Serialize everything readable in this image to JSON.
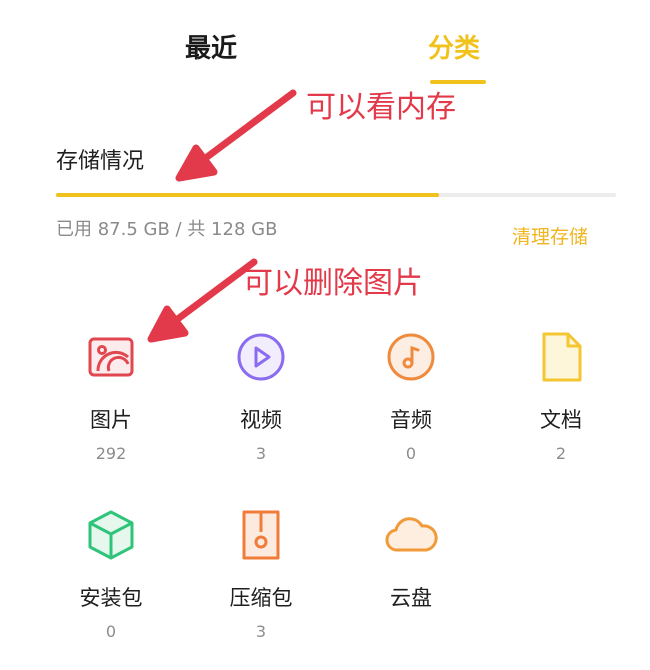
{
  "tabs": [
    {
      "label": "最近",
      "active": false
    },
    {
      "label": "分类",
      "active": true
    }
  ],
  "annotations": {
    "first": "可以看内存",
    "second": "可以删除图片",
    "color": "#e23a4a"
  },
  "storage": {
    "title": "存储情况",
    "usage_text": "已用 87.5 GB / 共 128 GB",
    "used_fraction": 0.684,
    "clean_label": "清理存储"
  },
  "categories": [
    {
      "label": "图片",
      "count": "292",
      "icon": "image-icon",
      "color": "#e0474e"
    },
    {
      "label": "视频",
      "count": "3",
      "icon": "video-play-icon",
      "color": "#8a6cf0"
    },
    {
      "label": "音频",
      "count": "0",
      "icon": "music-icon",
      "color": "#f08a3c"
    },
    {
      "label": "文档",
      "count": "2",
      "icon": "document-icon",
      "color": "#f3c632"
    },
    {
      "label": "安装包",
      "count": "0",
      "icon": "package-cube-icon",
      "color": "#2fc47a"
    },
    {
      "label": "压缩包",
      "count": "3",
      "icon": "zip-archive-icon",
      "color": "#f07c3a"
    },
    {
      "label": "云盘",
      "count": "",
      "icon": "cloud-icon",
      "color": "#f09a3a"
    }
  ],
  "colors": {
    "accent": "#f0c21b"
  }
}
